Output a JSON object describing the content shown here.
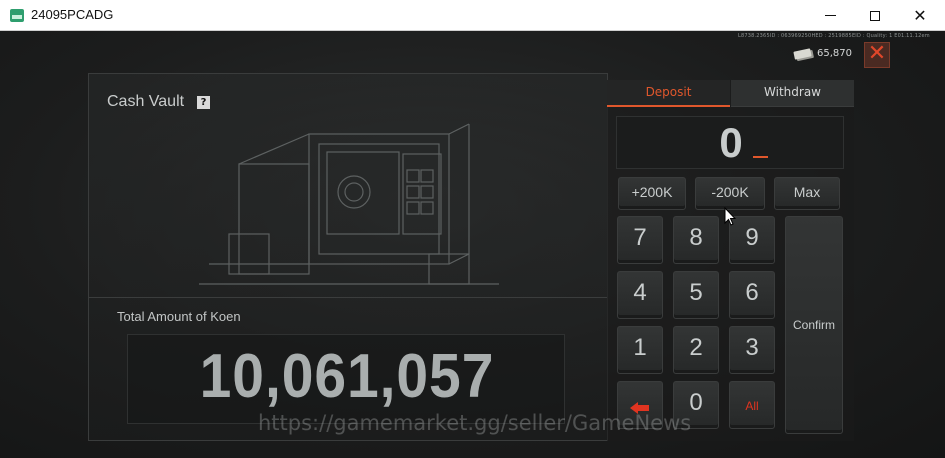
{
  "window": {
    "title": "24095PCADG"
  },
  "hud": {
    "id_text": "L8738.2365ID : 063969250HED : 2519885EID : Quality: 1 E01.11.12em",
    "koen_balance": "65,870",
    "exit_icon": "close-x-icon"
  },
  "vault": {
    "title": "Cash Vault",
    "help_label": "?",
    "total_label": "Total Amount of Koen",
    "total_value": "10,061,057"
  },
  "tabs": {
    "deposit": "Deposit",
    "withdraw": "Withdraw",
    "active": "deposit"
  },
  "input": {
    "display_value": "0"
  },
  "quick_buttons": {
    "plus": "+200K",
    "minus": "-200K",
    "max": "Max"
  },
  "keypad": {
    "k7": "7",
    "k8": "8",
    "k9": "9",
    "k4": "4",
    "k5": "5",
    "k6": "6",
    "k1": "1",
    "k2": "2",
    "k3": "3",
    "k0": "0",
    "all": "All",
    "backspace_icon": "backspace-arrow-icon",
    "confirm": "Confirm"
  },
  "watermark": "https://gamemarket.gg/seller/GameNews",
  "colors": {
    "accent": "#e0572c",
    "red": "#e03420",
    "text": "#c9cdcd"
  }
}
